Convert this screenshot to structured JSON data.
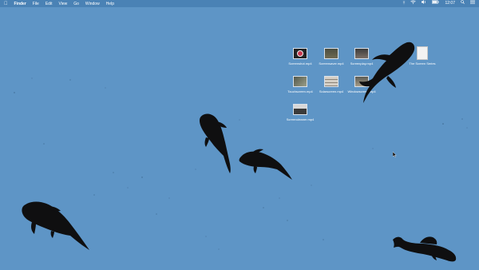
{
  "menubar": {
    "apple_icon": "apple-logo-icon",
    "app_name": "Finder",
    "menus": [
      "File",
      "Edit",
      "View",
      "Go",
      "Window",
      "Help"
    ],
    "status_icons": [
      "bluetooth-icon",
      "wifi-icon",
      "volume-icon",
      "battery-icon",
      "search-icon",
      "menu-list-icon"
    ],
    "clock": "12:07"
  },
  "desktop": {
    "background_color": "#5e95c6",
    "items": [
      {
        "label": "Screenshot.mp4",
        "icon": "video-thumbnail-icon"
      },
      {
        "label": "Screensaver.mp4",
        "icon": "video-thumbnail-icon"
      },
      {
        "label": "Screenplay.mp4",
        "icon": "video-thumbnail-icon"
      },
      {
        "label": "The Screen Series",
        "icon": "document-icon"
      },
      {
        "label": "Touchscreen.mp4",
        "icon": "video-thumbnail-icon"
      },
      {
        "label": "Solarscreen.mp4",
        "icon": "video-thumbnail-icon"
      },
      {
        "label": "Windowscreen.mp4",
        "icon": "video-thumbnail-icon"
      },
      {
        "label": "Screencleaner.mp4",
        "icon": "video-thumbnail-icon"
      }
    ]
  }
}
